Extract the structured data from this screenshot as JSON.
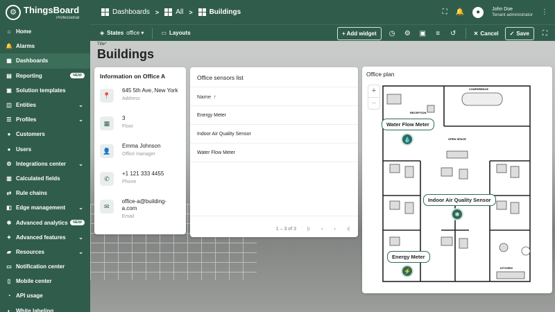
{
  "brand": {
    "name": "ThingsBoard",
    "edition": "Professional"
  },
  "sidebar": {
    "items": [
      {
        "label": "Home",
        "icon": "home-icon",
        "glyph": "⌂"
      },
      {
        "label": "Alarms",
        "icon": "bell-icon",
        "glyph": "🔔"
      },
      {
        "label": "Dashboards",
        "icon": "dashboard-icon",
        "glyph": "▦",
        "active": true
      },
      {
        "label": "Reporting",
        "icon": "report-icon",
        "glyph": "▤",
        "badge": "NEW"
      },
      {
        "label": "Solution templates",
        "icon": "template-icon",
        "glyph": "▣"
      },
      {
        "label": "Entities",
        "icon": "entities-icon",
        "glyph": "◫",
        "expand": true
      },
      {
        "label": "Profiles",
        "icon": "profiles-icon",
        "glyph": "☰",
        "expand": true
      },
      {
        "label": "Customers",
        "icon": "customers-icon",
        "glyph": "●"
      },
      {
        "label": "Users",
        "icon": "users-icon",
        "glyph": "●"
      },
      {
        "label": "Integrations center",
        "icon": "integrations-icon",
        "glyph": "⚙",
        "expand": true
      },
      {
        "label": "Calculated fields",
        "icon": "calc-icon",
        "glyph": "▥"
      },
      {
        "label": "Rule chains",
        "icon": "rule-chains-icon",
        "glyph": "⇄"
      },
      {
        "label": "Edge management",
        "icon": "edge-icon",
        "glyph": "◧",
        "expand": true
      },
      {
        "label": "Advanced analytics",
        "icon": "analytics-icon",
        "glyph": "✱",
        "badge": "NEW"
      },
      {
        "label": "Advanced features",
        "icon": "features-icon",
        "glyph": "✦",
        "expand": true
      },
      {
        "label": "Resources",
        "icon": "resources-icon",
        "glyph": "▰",
        "expand": true
      },
      {
        "label": "Notification center",
        "icon": "notification-icon",
        "glyph": "▭"
      },
      {
        "label": "Mobile center",
        "icon": "mobile-icon",
        "glyph": "▯"
      },
      {
        "label": "API usage",
        "icon": "api-icon",
        "glyph": "◔"
      },
      {
        "label": "White labeling",
        "icon": "paint-icon",
        "glyph": "◐"
      }
    ]
  },
  "breadcrumb": {
    "items": [
      "Dashboards",
      "All",
      "Buildings"
    ]
  },
  "user": {
    "name": "John Doe",
    "role": "Tenant administrator"
  },
  "toolbar": {
    "states_label": "States",
    "states_value": "office",
    "layouts_label": "Layouts",
    "add_widget_label": "+ Add widget",
    "cancel_label": "Cancel",
    "save_label": "Save"
  },
  "dashboard": {
    "title_label": "Title*",
    "title": "Buildings"
  },
  "info_card": {
    "title": "Information on Office A",
    "rows": [
      {
        "value": "645 5th Ave, New York",
        "key": "Address",
        "icon": "location-icon",
        "glyph": "📍"
      },
      {
        "value": "3",
        "key": "Floor",
        "icon": "floor-icon",
        "glyph": "▦"
      },
      {
        "value": "Emma Johnson",
        "key": "Office manager",
        "icon": "person-icon",
        "glyph": "👤"
      },
      {
        "value": "+1 121 333 4455",
        "key": "Phone",
        "icon": "phone-icon",
        "glyph": "✆"
      },
      {
        "value": "office-a@building-a.com",
        "key": "Email",
        "icon": "email-icon",
        "glyph": "✉"
      }
    ]
  },
  "sensors_card": {
    "title": "Office sensors list",
    "column": "Name",
    "rows": [
      "Energy Meter",
      "Indoor Air Quality Sensor",
      "Water Flow Meter"
    ],
    "range": "1 – 3 of 3"
  },
  "plan_card": {
    "title": "Office plan",
    "rooms": [
      "CONFERENCE",
      "RECEPTION",
      "OPEN SPACE",
      "KITCHEN"
    ],
    "markers": [
      {
        "label": "Water Flow Meter"
      },
      {
        "label": "Indoor Air Quality Sensor"
      },
      {
        "label": "Energy Meter"
      }
    ]
  },
  "colors": {
    "primary": "#305c4b",
    "accent": "#2f6b55"
  }
}
